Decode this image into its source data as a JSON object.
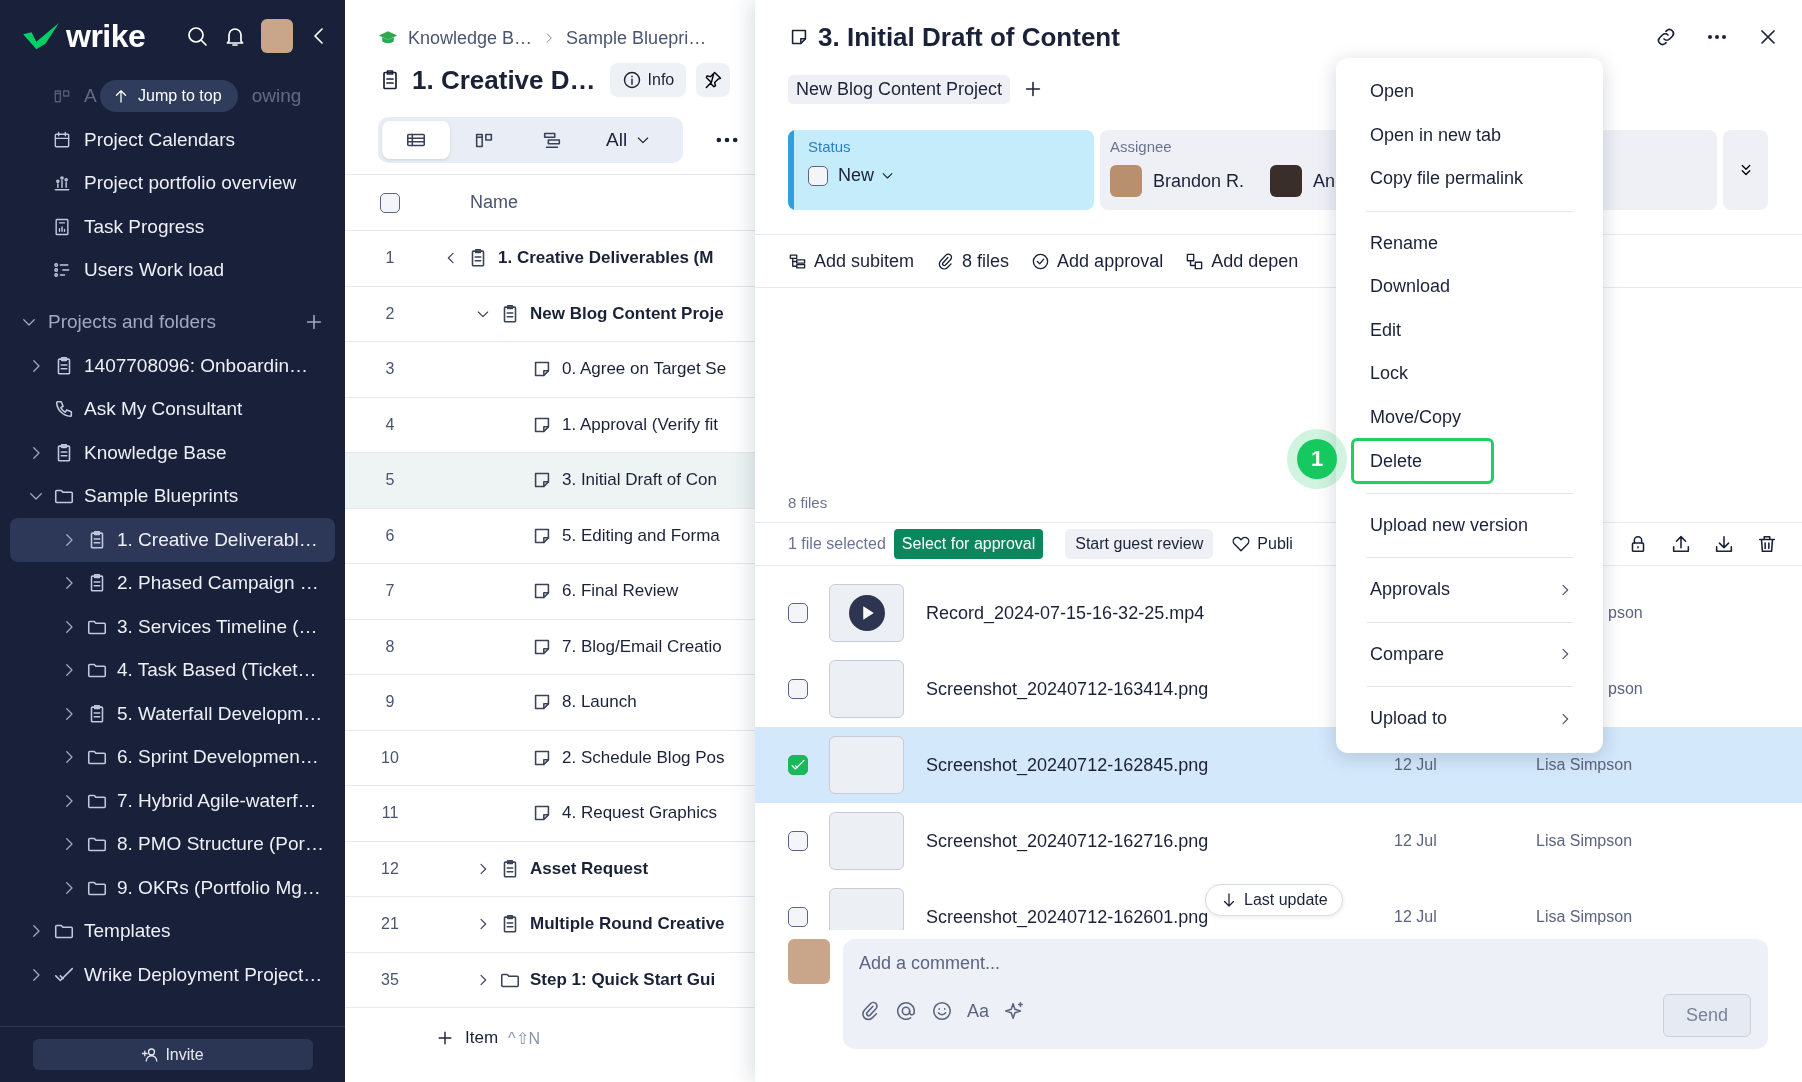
{
  "sidebar": {
    "logo": "wrike",
    "partial_item": {
      "text_start": "A",
      "text_end": "owing"
    },
    "jump_to_top": "Jump to top",
    "nav": [
      {
        "kind": "calendar",
        "label": "Project Calendars"
      },
      {
        "kind": "portfolio",
        "label": "Project portfolio overview"
      },
      {
        "kind": "progress",
        "label": "Task Progress"
      },
      {
        "kind": "workload",
        "label": "Users Work load"
      }
    ],
    "section": {
      "label": "Projects and folders",
      "expanded": true
    },
    "tree": [
      {
        "label": "1407708096: Onboardin…",
        "kind": "project",
        "expanded": false,
        "selected": false
      },
      {
        "label": "Ask My Consultant",
        "kind": "phone",
        "selected": false
      },
      {
        "label": "Knowledge Base",
        "kind": "project",
        "expanded": false,
        "selected": false
      },
      {
        "label": "Sample Blueprints",
        "kind": "folder",
        "expanded": true,
        "selected": false,
        "children": [
          {
            "label": "1. Creative Deliverabl…",
            "kind": "project",
            "expanded": false,
            "selected": true
          },
          {
            "label": "2. Phased Campaign …",
            "kind": "project",
            "expanded": false,
            "selected": false
          },
          {
            "label": "3. Services Timeline (…",
            "kind": "folder",
            "expanded": false,
            "selected": false
          },
          {
            "label": "4. Task Based (Ticket…",
            "kind": "folder",
            "expanded": false,
            "selected": false
          },
          {
            "label": "5. Waterfall Developm…",
            "kind": "project",
            "expanded": false,
            "selected": false
          },
          {
            "label": "6. Sprint Developmen…",
            "kind": "folder",
            "expanded": false,
            "selected": false
          },
          {
            "label": "7. Hybrid Agile-waterf…",
            "kind": "folder",
            "expanded": false,
            "selected": false
          },
          {
            "label": "8. PMO Structure (Por…",
            "kind": "folder",
            "expanded": false,
            "selected": false
          },
          {
            "label": "9. OKRs (Portfolio Mg…",
            "kind": "folder",
            "expanded": false,
            "selected": false
          }
        ]
      },
      {
        "label": "Templates",
        "kind": "folder",
        "expanded": false,
        "selected": false
      },
      {
        "label": "Wrike Deployment Project…",
        "kind": "check",
        "expanded": false,
        "selected": false
      }
    ],
    "invite": "Invite"
  },
  "list": {
    "breadcrumbs": [
      "Knowledge B…",
      "Sample Bluepri…"
    ],
    "title": "1. Creative D…",
    "info": "Info",
    "views": [
      {
        "kind": "table",
        "selected": true
      },
      {
        "kind": "board",
        "selected": false
      },
      {
        "kind": "gantt",
        "selected": false
      }
    ],
    "filter": "All",
    "column": "Name",
    "header_checked": false,
    "rows": [
      {
        "number": "1",
        "name": "1. Creative Deliverables (M",
        "kind": "project",
        "expanded": true,
        "selected": false,
        "children": [
          {
            "number": "2",
            "name": "New Blog Content Proje",
            "kind": "project",
            "expanded": true,
            "selected": false,
            "children": [
              {
                "number": "3",
                "name": "0. Agree on Target Se",
                "kind": "task",
                "selected": false
              },
              {
                "number": "4",
                "name": "1. Approval (Verify fit",
                "kind": "task",
                "selected": false
              },
              {
                "number": "5",
                "name": "3. Initial Draft of Con",
                "kind": "task",
                "selected": true
              },
              {
                "number": "6",
                "name": "5. Editing and Forma",
                "kind": "task",
                "selected": false
              },
              {
                "number": "7",
                "name": "6. Final Review",
                "kind": "task",
                "selected": false
              },
              {
                "number": "8",
                "name": "7. Blog/Email Creatio",
                "kind": "task",
                "selected": false
              },
              {
                "number": "9",
                "name": "8. Launch",
                "kind": "task",
                "selected": false
              },
              {
                "number": "10",
                "name": "2. Schedule Blog Pos",
                "kind": "task",
                "selected": false
              },
              {
                "number": "11",
                "name": "4. Request Graphics",
                "kind": "task",
                "selected": false
              }
            ]
          },
          {
            "number": "12",
            "name": "Asset Request",
            "kind": "project",
            "expanded": false,
            "selected": false
          },
          {
            "number": "21",
            "name": "Multiple Round Creative",
            "kind": "project",
            "expanded": false,
            "selected": false
          },
          {
            "number": "35",
            "name": "Step 1: Quick Start Gui",
            "kind": "folder",
            "expanded": false,
            "selected": false
          }
        ]
      }
    ],
    "add_item": "Item",
    "shortcut": "^⇧N"
  },
  "task": {
    "title": "3. Initial Draft of Content",
    "parent_tag": "New Blog Content Project",
    "status": {
      "label": "Status",
      "value": "New",
      "checked": false
    },
    "assignee": {
      "label": "Assignee",
      "people": [
        "Brandon R.",
        "An"
      ]
    },
    "actions": [
      {
        "kind": "subitem",
        "label": "Add subitem"
      },
      {
        "kind": "attach",
        "label": "8 files"
      },
      {
        "kind": "approval",
        "label": "Add approval"
      },
      {
        "kind": "dependency",
        "label": "Add depen"
      }
    ],
    "files_count": "8 files",
    "selection": {
      "count": "1 file selected",
      "approval_button": "Select for approval",
      "review_button": "Start guest review",
      "publish": "Publi"
    },
    "files": [
      {
        "kind": "video",
        "name": "Record_2024-07-15-16-32-25.mp4",
        "author": "pson",
        "checked": false,
        "selected": false
      },
      {
        "kind": "image",
        "name": "Screenshot_20240712-163414.png",
        "author": "pson",
        "checked": false,
        "selected": false
      },
      {
        "kind": "image",
        "name": "Screenshot_20240712-162845.png",
        "date": "12 Jul",
        "author": "Lisa Simpson",
        "checked": true,
        "selected": true
      },
      {
        "kind": "image",
        "name": "Screenshot_20240712-162716.png",
        "date": "12 Jul",
        "author": "Lisa Simpson",
        "checked": false,
        "selected": false
      },
      {
        "kind": "image",
        "name": "Screenshot_20240712-162601.png",
        "date": "12 Jul",
        "author": "Lisa Simpson",
        "checked": false,
        "selected": false
      }
    ],
    "last_update": "Last update",
    "comment": {
      "placeholder": "Add a comment...",
      "format_label": "Aa",
      "send": "Send"
    },
    "menu": [
      {
        "items": [
          {
            "label": "Open",
            "submenu": false,
            "highlighted": false
          },
          {
            "label": "Open in new tab",
            "submenu": false,
            "highlighted": false
          },
          {
            "label": "Copy file permalink",
            "submenu": false,
            "highlighted": false
          }
        ]
      },
      {
        "items": [
          {
            "label": "Rename",
            "submenu": false,
            "highlighted": false
          },
          {
            "label": "Download",
            "submenu": false,
            "highlighted": false
          },
          {
            "label": "Edit",
            "submenu": false,
            "highlighted": false
          },
          {
            "label": "Lock",
            "submenu": false,
            "highlighted": false
          },
          {
            "label": "Move/Copy",
            "submenu": false,
            "highlighted": false
          },
          {
            "label": "Delete",
            "submenu": false,
            "highlighted": true,
            "callout": "1"
          }
        ]
      },
      {
        "items": [
          {
            "label": "Upload new version",
            "submenu": false,
            "highlighted": false
          }
        ]
      },
      {
        "items": [
          {
            "label": "Approvals",
            "submenu": true,
            "highlighted": false
          }
        ]
      },
      {
        "items": [
          {
            "label": "Compare",
            "submenu": true,
            "highlighted": false
          }
        ]
      },
      {
        "items": [
          {
            "label": "Upload to",
            "submenu": true,
            "highlighted": false
          }
        ]
      }
    ]
  }
}
